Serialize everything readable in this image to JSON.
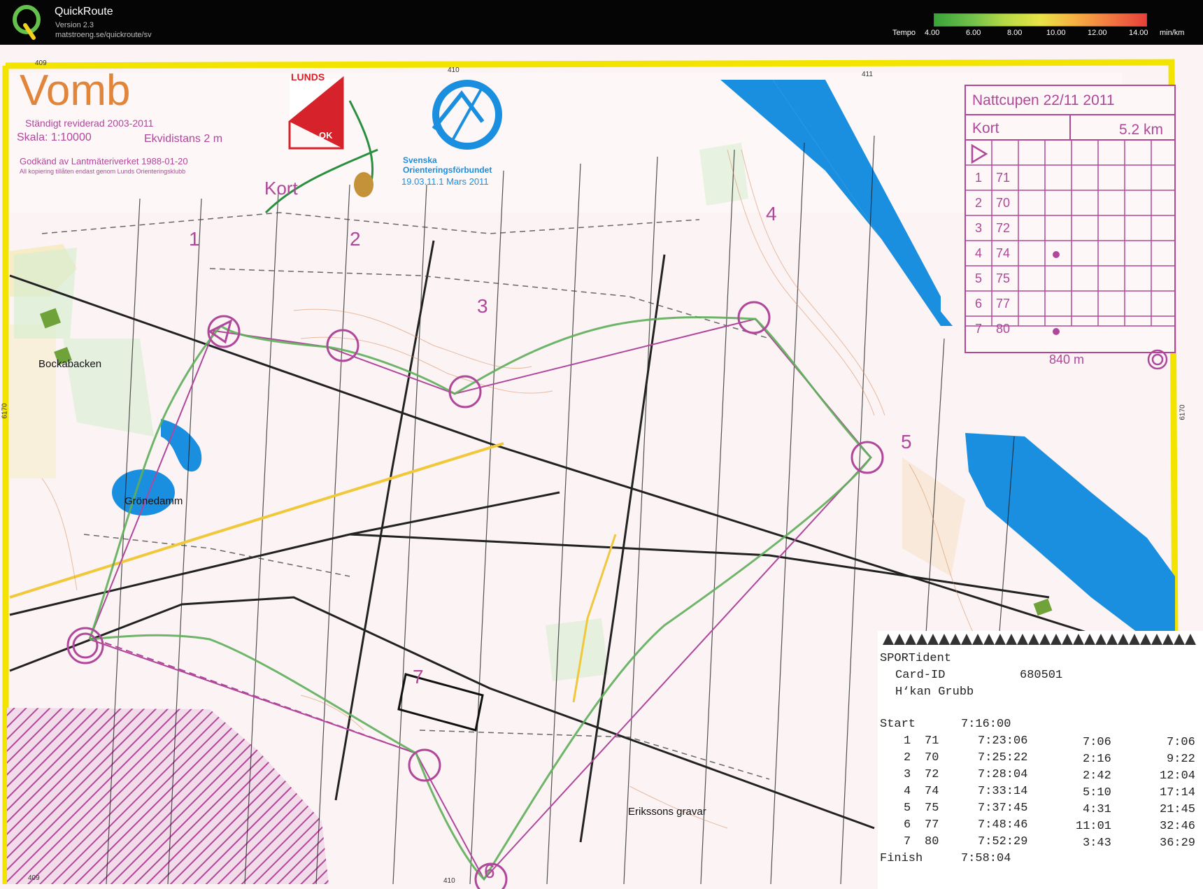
{
  "app": {
    "name": "QuickRoute",
    "version": "Version 2.3",
    "url": "matstroeng.se/quickroute/sv"
  },
  "tempo_legend": {
    "label": "Tempo",
    "ticks": [
      "4.00",
      "6.00",
      "8.00",
      "10.00",
      "12.00",
      "14.00"
    ],
    "unit": "min/km"
  },
  "map": {
    "title": "Vomb",
    "revised": "Ständigt reviderad 2003-2011",
    "scale": "Skala: 1:10000",
    "contour": "Ekvidistans 2 m",
    "approved": "Godkänd av Lantmäteriverket 1988-01-20",
    "copyright": "All kopiering tillåten endast genom Lunds Orienteringsklubb",
    "course_label": "Kort",
    "lunds_logo": {
      "top": "LUNDS",
      "bottom": "OK"
    },
    "sof_logo": {
      "line1": "Svenska",
      "line2": "Orienteringsförbundet",
      "line3": "19.03.11.1 Mars 2011"
    },
    "grid_labels": [
      "409",
      "410",
      "411",
      "6170",
      "6170",
      "409",
      "410"
    ],
    "place_names": [
      "Bockabacken",
      "Grönedamm",
      "Erikssons gravar"
    ],
    "control_numbers": [
      "1",
      "2",
      "3",
      "4",
      "5",
      "6",
      "7"
    ]
  },
  "course_card": {
    "event": "Nattcupen 22/11 2011",
    "class": "Kort",
    "length": "5.2 km",
    "rows": [
      {
        "num": "1",
        "code": "71"
      },
      {
        "num": "2",
        "code": "70"
      },
      {
        "num": "3",
        "code": "72"
      },
      {
        "num": "4",
        "code": "74"
      },
      {
        "num": "5",
        "code": "75"
      },
      {
        "num": "6",
        "code": "77"
      },
      {
        "num": "7",
        "code": "80"
      }
    ],
    "finish_distance": "840 m"
  },
  "sportident": {
    "brand": "SPORTident",
    "card_label": "Card-ID",
    "card_id": "680501",
    "runner": "H‘kan Grubb",
    "start_label": "Start",
    "start_time": "7:16:00",
    "splits": [
      {
        "n": "1",
        "code": "71",
        "time": "7:23:06",
        "split": "7:06",
        "total": "7:06"
      },
      {
        "n": "2",
        "code": "70",
        "time": "7:25:22",
        "split": "2:16",
        "total": "9:22"
      },
      {
        "n": "3",
        "code": "72",
        "time": "7:28:04",
        "split": "2:42",
        "total": "12:04"
      },
      {
        "n": "4",
        "code": "74",
        "time": "7:33:14",
        "split": "5:10",
        "total": "17:14"
      },
      {
        "n": "5",
        "code": "75",
        "time": "7:37:45",
        "split": "4:31",
        "total": "21:45"
      },
      {
        "n": "6",
        "code": "77",
        "time": "7:48:46",
        "split": "11:01",
        "total": "32:46"
      },
      {
        "n": "7",
        "code": "80",
        "time": "7:52:29",
        "split": "3:43",
        "total": "36:29"
      }
    ],
    "finish_label": "Finish",
    "finish_time": "7:58:04"
  },
  "colors": {
    "border_yellow": "#f3e400",
    "course_purple": "#b0479b",
    "water_blue": "#1a8fe0",
    "route_green": "#5fae5a",
    "paper": "#fbf3f4"
  }
}
